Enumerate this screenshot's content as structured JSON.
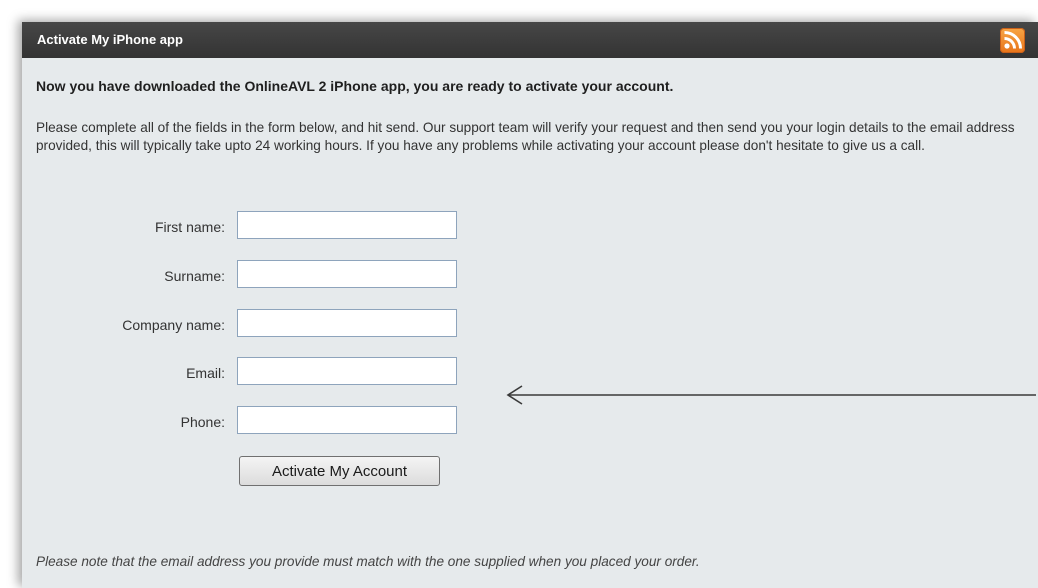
{
  "header": {
    "title": "Activate My iPhone app",
    "rss_icon": "rss-feed-icon",
    "rss_color": "#e8741a"
  },
  "intro": "Now you have downloaded the OnlineAVL 2 iPhone app, you are ready to activate your account.",
  "description": "Please complete all of the fields in the form below, and hit send. Our support team will verify your request and then send you your login details to the email address provided, this will typically take upto 24 working hours. If you have any problems while activating your account please don't hesitate to give us a call.",
  "form": {
    "fields": [
      {
        "label": "First name:",
        "value": ""
      },
      {
        "label": "Surname:",
        "value": ""
      },
      {
        "label": "Company name:",
        "value": ""
      },
      {
        "label": "Email:",
        "value": ""
      },
      {
        "label": "Phone:",
        "value": ""
      }
    ],
    "submit_label": "Activate My Account"
  },
  "note": "Please note that the email address you provide must match with the one supplied when you placed your order.",
  "colors": {
    "header_bg": "#3d3d3d",
    "panel_bg": "#e6eaec",
    "input_border": "#8ea4bc"
  }
}
